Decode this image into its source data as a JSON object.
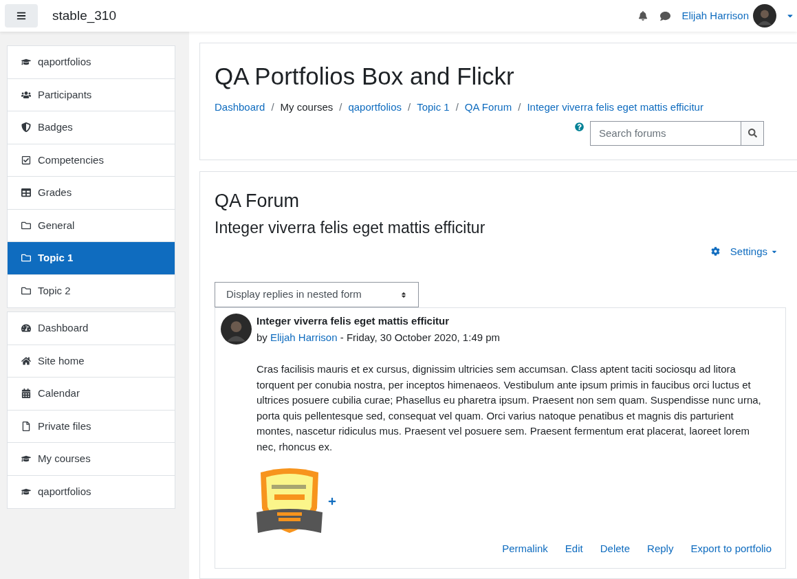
{
  "navbar": {
    "site_name": "stable_310",
    "user_name": "Elijah Harrison"
  },
  "sidebar": {
    "groups": [
      {
        "items": [
          {
            "label": "qaportfolios",
            "selected": false
          },
          {
            "label": "Participants",
            "selected": false
          },
          {
            "label": "Badges",
            "selected": false
          },
          {
            "label": "Competencies",
            "selected": false
          },
          {
            "label": "Grades",
            "selected": false
          },
          {
            "label": "General",
            "selected": false
          },
          {
            "label": "Topic 1",
            "selected": true
          },
          {
            "label": "Topic 2",
            "selected": false
          }
        ]
      },
      {
        "items": [
          {
            "label": "Dashboard",
            "selected": false
          },
          {
            "label": "Site home",
            "selected": false
          },
          {
            "label": "Calendar",
            "selected": false
          },
          {
            "label": "Private files",
            "selected": false
          },
          {
            "label": "My courses",
            "selected": false
          },
          {
            "label": "qaportfolios",
            "selected": false
          }
        ]
      }
    ]
  },
  "header": {
    "title": "QA Portfolios Box and Flickr",
    "breadcrumb": [
      {
        "label": "Dashboard",
        "kind": "link"
      },
      {
        "label": "My courses",
        "kind": "text"
      },
      {
        "label": "qaportfolios",
        "kind": "link"
      },
      {
        "label": "Topic 1",
        "kind": "link"
      },
      {
        "label": "QA Forum",
        "kind": "link"
      },
      {
        "label": "Integer viverra felis eget mattis efficitur",
        "kind": "link"
      }
    ],
    "breadcrumb_separator": "/",
    "search": {
      "placeholder": "Search forums"
    }
  },
  "forum": {
    "title": "QA Forum",
    "discussion_title": "Integer viverra felis eget mattis efficitur",
    "settings_label": "Settings",
    "display_mode": "Display replies in nested form",
    "post": {
      "subject": "Integer viverra felis eget mattis efficitur",
      "by": "by",
      "author": "Elijah Harrison",
      "date": "- Friday, 30 October 2020, 1:49 pm",
      "body": "Cras facilisis mauris et ex cursus, dignissim ultricies sem accumsan. Class aptent taciti sociosqu ad litora torquent per conubia nostra, per inceptos himenaeos. Vestibulum ante ipsum primis in faucibus orci luctus et ultrices posuere cubilia curae; Phasellus eu pharetra ipsum. Praesent non sem quam. Suspendisse nunc urna, porta quis pellentesque sed, consequat vel quam. Orci varius natoque penatibus et magnis dis parturient montes, nascetur ridiculus mus. Praesent vel posuere sem. Praesent fermentum erat placerat, laoreet lorem nec, rhoncus ex.",
      "actions": [
        "Permalink",
        "Edit",
        "Delete",
        "Reply",
        "Export to portfolio"
      ]
    }
  }
}
